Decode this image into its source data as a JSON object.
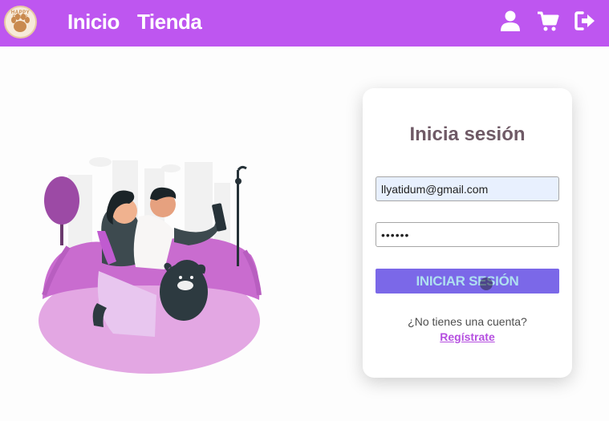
{
  "navbar": {
    "logo_text": "HAPPY PAWS",
    "links": [
      {
        "label": "Inicio"
      },
      {
        "label": "Tienda"
      }
    ],
    "icons": [
      "user-icon",
      "cart-icon",
      "logout-icon"
    ]
  },
  "login": {
    "title": "Inicia sesión",
    "email_value": "llyatidum@gmail.com",
    "password_value": "••••••",
    "submit_label": "INICIAR SESIÓN",
    "no_account_text": "¿No tienes una cuenta?",
    "register_link": "Regístrate"
  },
  "colors": {
    "navbar": "#be56f0",
    "button": "#7b68e8",
    "button_text": "#aedff0",
    "link": "#b54fe0"
  }
}
